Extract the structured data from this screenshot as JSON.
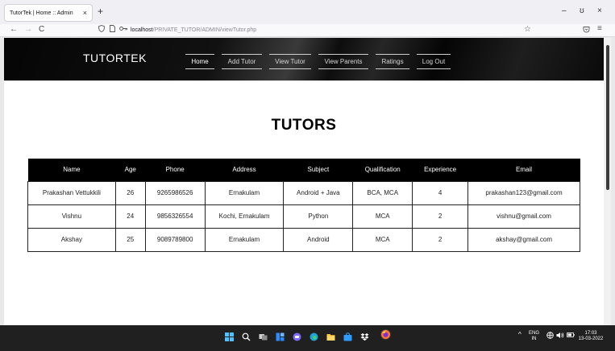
{
  "browser": {
    "tab_title": "TutorTek | Home :: Admin",
    "tab_close": "×",
    "new_tab": "+",
    "window_controls": {
      "minimize": "–",
      "restore": "ʊ",
      "close": "×"
    },
    "nav": {
      "back": "←",
      "forward": "→",
      "reload": "C"
    },
    "url": {
      "host": "localhost",
      "path": "/PRIVATE_TUTOR/ADMIN/viewTutor.php"
    },
    "toolbar_icons": [
      "shield-icon",
      "page-icon",
      "key-icon",
      "star-icon",
      "pocket-icon",
      "menu-icon"
    ]
  },
  "site": {
    "brand": "TUTORTEK",
    "menu": [
      {
        "label": "Home",
        "active": true
      },
      {
        "label": "Add Tutor",
        "active": false
      },
      {
        "label": "View Tutor",
        "active": false
      },
      {
        "label": "View Parents",
        "active": false
      },
      {
        "label": "Ratings",
        "active": false
      },
      {
        "label": "Log Out",
        "active": false
      }
    ]
  },
  "main": {
    "title": "TUTORS",
    "table": {
      "headers": [
        "Name",
        "Age",
        "Phone",
        "Address",
        "Subject",
        "Qualification",
        "Experience",
        "Email"
      ],
      "rows": [
        [
          "Prakashan Vettukkili",
          "26",
          "9265986526",
          "Ernakulam",
          "Android + Java",
          "BCA, MCA",
          "4",
          "prakashan123@gmail.com"
        ],
        [
          "Vishnu",
          "24",
          "9856326554",
          "Kochi, Ernakulam",
          "Python",
          "MCA",
          "2",
          "vishnu@gmail.com"
        ],
        [
          "Akshay",
          "25",
          "9089789800",
          "Ernakulam",
          "Android",
          "MCA",
          "2",
          "akshay@gmail.com"
        ]
      ]
    }
  },
  "taskbar": {
    "icons": [
      "windows-start-icon",
      "search-icon",
      "task-view-icon",
      "widgets-icon",
      "chat-icon",
      "edge-icon",
      "file-explorer-icon",
      "store-icon",
      "dropbox-icon",
      "firefox-icon"
    ],
    "tray": {
      "lang_top": "ENG",
      "lang_bottom": "IN",
      "time": "17:03",
      "date": "13-03-2022"
    }
  },
  "colors": {
    "header_bg": "#0a0a0a",
    "table_header_bg": "#000000",
    "taskbar_bg": "#202020"
  }
}
